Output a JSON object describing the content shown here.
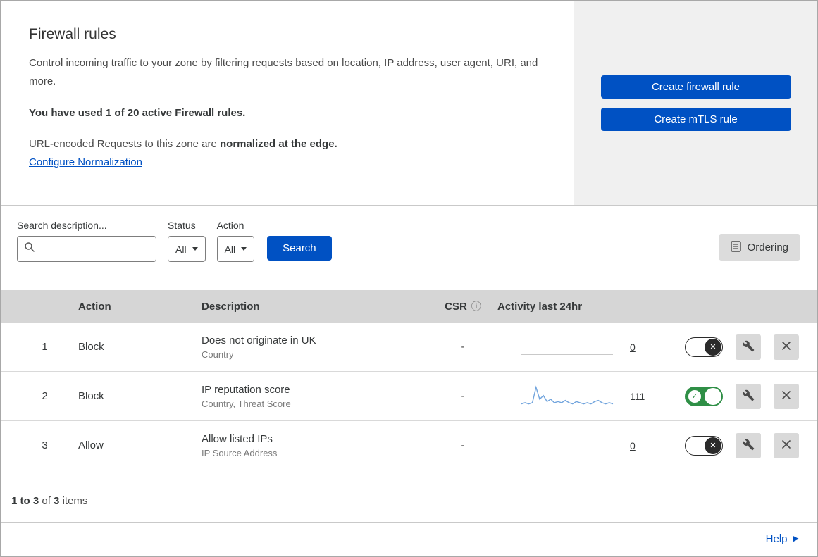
{
  "header": {
    "title": "Firewall rules",
    "description": "Control incoming traffic to your zone by filtering requests based on location, IP address, user agent, URI, and more.",
    "usage": "You have used 1 of 20 active Firewall rules.",
    "normalization_prefix": "URL-encoded Requests to this zone are ",
    "normalization_bold": "normalized at the edge.",
    "normalization_link": "Configure Normalization",
    "buttons": {
      "create_firewall": "Create firewall rule",
      "create_mtls": "Create mTLS rule"
    }
  },
  "filters": {
    "search_label": "Search description...",
    "search_value": "",
    "status_label": "Status",
    "status_value": "All",
    "action_label": "Action",
    "action_value": "All",
    "search_button": "Search",
    "ordering_button": "Ordering"
  },
  "table": {
    "columns": {
      "action": "Action",
      "description": "Description",
      "csr": "CSR",
      "activity": "Activity last 24hr"
    },
    "rows": [
      {
        "index": "1",
        "action": "Block",
        "description": "Does not originate in UK",
        "fields": "Country",
        "csr": "-",
        "activity_count": "0",
        "enabled": false,
        "sparkline": []
      },
      {
        "index": "2",
        "action": "Block",
        "description": "IP reputation score",
        "fields": "Country, Threat Score",
        "csr": "-",
        "activity_count": "111",
        "enabled": true,
        "sparkline": [
          2,
          3,
          2,
          3,
          16,
          6,
          9,
          4,
          6,
          3,
          4,
          3,
          5,
          3,
          2,
          4,
          3,
          2,
          3,
          2,
          4,
          5,
          3,
          2,
          3,
          2
        ]
      },
      {
        "index": "3",
        "action": "Allow",
        "description": "Allow listed IPs",
        "fields": "IP Source Address",
        "csr": "-",
        "activity_count": "0",
        "enabled": false,
        "sparkline": []
      }
    ],
    "footer": {
      "range": "1 to 3",
      "of": "of",
      "total": "3",
      "items": "items"
    }
  },
  "help": {
    "label": "Help"
  },
  "colors": {
    "accent_blue": "#0051c3",
    "toggle_on_green": "#2f8f46",
    "sparkline_blue": "#71a4dd",
    "panel_gray": "#f0f0f0",
    "table_header_gray": "#d6d6d6"
  }
}
